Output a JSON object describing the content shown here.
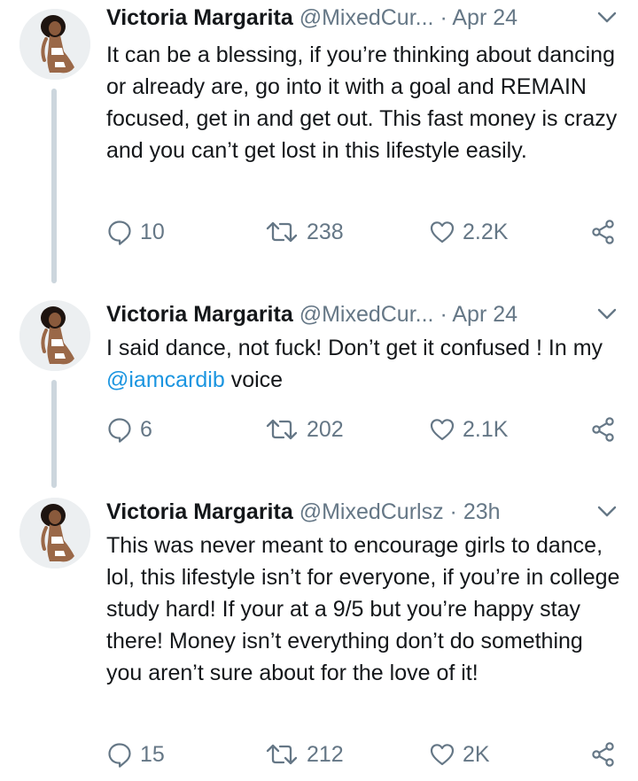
{
  "colors": {
    "text": "#14171a",
    "secondary": "#657786",
    "link": "#1b95e0",
    "thread_line": "#ccd6dd"
  },
  "tweets": [
    {
      "name": "Victoria Margarita",
      "handle": "@MixedCur...",
      "dot": "·",
      "time": "Apr 24",
      "text": "It can be a blessing, if you’re thinking about dancing or already are, go into it with a goal and REMAIN focused, get in and get out. This fast money is crazy and you can’t get lost in this lifestyle easily.",
      "replies": "10",
      "retweets": "238",
      "likes": "2.2K"
    },
    {
      "name": "Victoria Margarita",
      "handle": "@MixedCur...",
      "dot": "·",
      "time": "Apr 24",
      "text_before": "I said dance, not fuck! Don’t get it confused ! In my ",
      "mention": "@iamcardib",
      "text_after": " voice",
      "replies": "6",
      "retweets": "202",
      "likes": "2.1K"
    },
    {
      "name": "Victoria Margarita",
      "handle": "@MixedCurlsz",
      "dot": "·",
      "time": "23h",
      "text": "This was never meant to encourage girls to dance, lol, this lifestyle isn’t for everyone, if you’re in college study hard! If your at a 9/5 but you’re happy stay there! Money isn’t everything don’t do something you aren’t sure about for the love of it!",
      "replies": "15",
      "retweets": "212",
      "likes": "2K"
    }
  ]
}
